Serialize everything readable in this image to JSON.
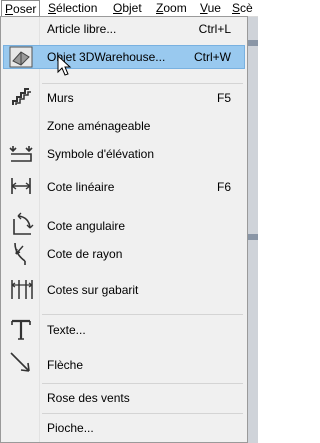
{
  "menubar": {
    "items": [
      {
        "label": "Poser",
        "accel": "P",
        "rest": "oser"
      },
      {
        "label": "Sélection",
        "accel": "S",
        "rest": "élection"
      },
      {
        "label": "Objet",
        "accel": "O",
        "rest": "bjet"
      },
      {
        "label": "Zoom",
        "accel": "Z",
        "rest": "oom"
      },
      {
        "label": "Vue",
        "accel": "V",
        "rest": "ue"
      },
      {
        "label": "Scè",
        "accel": "S",
        "rest": "cè"
      }
    ]
  },
  "menu": {
    "items": [
      {
        "label": "Article libre...",
        "shortcut": "Ctrl+L",
        "icon": "none"
      },
      {
        "label": "Objet 3DWarehouse...",
        "shortcut": "Ctrl+W",
        "icon": "3d-warehouse-icon",
        "highlighted": true
      },
      {
        "label": "Murs",
        "shortcut": "F5",
        "icon": "wall-icon"
      },
      {
        "label": "Zone aménageable",
        "shortcut": "",
        "icon": "none"
      },
      {
        "label": "Symbole d'élévation",
        "shortcut": "",
        "icon": "elevation-symbol-icon"
      },
      {
        "label": "Cote linéaire",
        "shortcut": "F6",
        "icon": "linear-dimension-icon"
      },
      {
        "label": "Cote angulaire",
        "shortcut": "",
        "icon": "angular-dimension-icon"
      },
      {
        "label": "Cote de rayon",
        "shortcut": "",
        "icon": "radius-dimension-icon"
      },
      {
        "label": "Cotes sur gabarit",
        "shortcut": "",
        "icon": "template-dimensions-icon"
      },
      {
        "label": "Texte...",
        "shortcut": "",
        "icon": "text-icon"
      },
      {
        "label": "Flèche",
        "shortcut": "",
        "icon": "arrow-icon"
      },
      {
        "label": "Rose des vents",
        "shortcut": "",
        "icon": "none"
      },
      {
        "label": "Pioche...",
        "shortcut": "",
        "icon": "none"
      }
    ]
  },
  "colors": {
    "menu_bg": "#f0f0f0",
    "highlight_bg": "#99c9ef",
    "highlight_border": "#79b1e0",
    "separator": "#d4d4d4"
  }
}
